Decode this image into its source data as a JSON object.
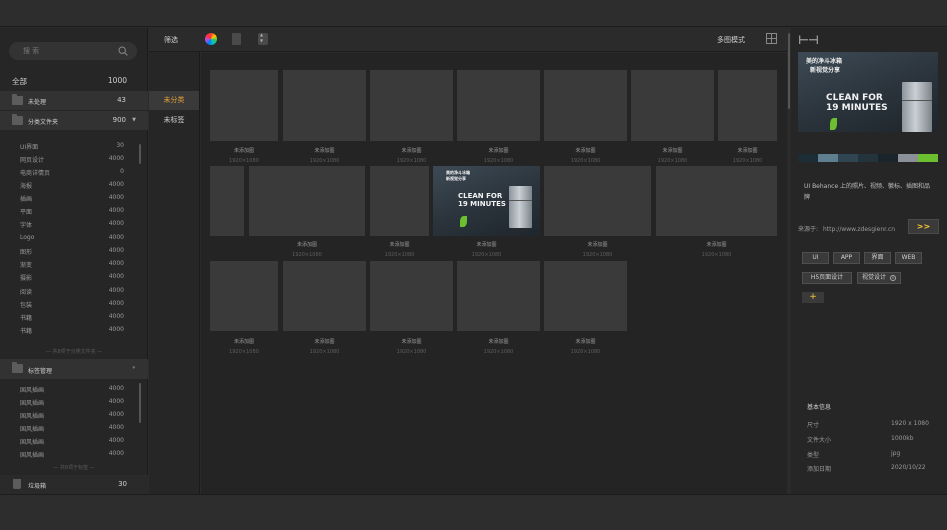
{
  "search": {
    "placeholder": "搜 索"
  },
  "sidebar": {
    "all": {
      "label": "全部",
      "count": "1000"
    },
    "unprocessed": {
      "label": "未处理",
      "count": "43"
    },
    "folders": {
      "label": "分类文件夹",
      "count": "900"
    },
    "categories": [
      {
        "label": "UI界面",
        "count": "30"
      },
      {
        "label": "网页设计",
        "count": "4000"
      },
      {
        "label": "电商详情页",
        "count": "0"
      },
      {
        "label": "海报",
        "count": "4000"
      },
      {
        "label": "插画",
        "count": "4000"
      },
      {
        "label": "平面",
        "count": "4000"
      },
      {
        "label": "字体",
        "count": "4000"
      },
      {
        "label": "Logo",
        "count": "4000"
      },
      {
        "label": "图形",
        "count": "4000"
      },
      {
        "label": "渐变",
        "count": "4000"
      },
      {
        "label": "摄影",
        "count": "4000"
      },
      {
        "label": "阅读",
        "count": "4000"
      },
      {
        "label": "包装",
        "count": "4000"
      },
      {
        "label": "书籍",
        "count": "4000"
      },
      {
        "label": "书籍",
        "count": "4000"
      }
    ],
    "categories_hint": "— 共8项于分类文件夹 —",
    "tag_manage": {
      "label": "标签管理"
    },
    "tags": [
      {
        "label": "国风插画",
        "count": "4000"
      },
      {
        "label": "国风插画",
        "count": "4000"
      },
      {
        "label": "国风插画",
        "count": "4000"
      },
      {
        "label": "国风插画",
        "count": "4000"
      },
      {
        "label": "国风插画",
        "count": "4000"
      },
      {
        "label": "国风插画",
        "count": "4000"
      }
    ],
    "tags_hint": "— 共8项于标签 —",
    "trash": {
      "label": "垃圾箱",
      "count": "30"
    }
  },
  "col2": {
    "unsorted": "未分类",
    "untagged": "未标签"
  },
  "toolbar": {
    "filter": "筛选",
    "mode": "多图模式"
  },
  "grid": {
    "placeholder_title": "未添加图",
    "placeholder_size": "1920×1080",
    "featured_title": "未添加图",
    "featured_size": "1920×1080"
  },
  "image_text": {
    "line1": "美的净斗冰箱",
    "line2": "新视觉分享",
    "big1": "CLEAN FOR",
    "big2": "19 MINUTES"
  },
  "detail": {
    "palette": [
      "#1d2d36",
      "#5d7f8f",
      "#2f4652",
      "#24343d",
      "#19252b",
      "#8b9196",
      "#6cbf2f"
    ],
    "description": "UI Behance 上的照片、视频、徽标、插图和品牌",
    "source_label": "来源于:",
    "source_url": "http://www.zdesgienr.cn",
    "go_label": ">>",
    "tags": [
      "UI",
      "APP",
      "界面",
      "WEB",
      "H5页面设计",
      "视觉设计"
    ],
    "add_label": "+",
    "info_title": "基本信息",
    "info": [
      {
        "k": "尺寸",
        "v": "1920 x 1080"
      },
      {
        "k": "文件大小",
        "v": "1000kb"
      },
      {
        "k": "类型",
        "v": "jpg"
      },
      {
        "k": "添加日期",
        "v": "2020/10/22"
      }
    ]
  }
}
